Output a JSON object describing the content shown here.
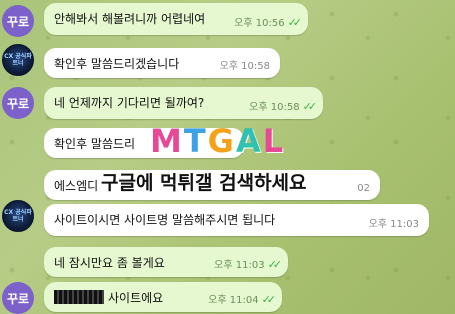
{
  "avatars": {
    "user_label": "꾸로",
    "agent_label": "CX\n공식파트너"
  },
  "messages": [
    {
      "id": "m1",
      "direction": "out",
      "text": "안해봐서 해볼려니까 어렵네여",
      "time": "오후 10:56",
      "ticks": "✓✓"
    },
    {
      "id": "m2",
      "direction": "in",
      "text": "확인후 말씀드리겠습니다",
      "time": "오후 10:58"
    },
    {
      "id": "m3",
      "direction": "out",
      "text": "네 언제까지 기다리면 될까여?",
      "time": "오후 10:58",
      "ticks": "✓✓"
    },
    {
      "id": "m4",
      "direction": "in",
      "text": "확인후 말씀드리",
      "time": ""
    },
    {
      "id": "m5",
      "direction": "in",
      "text": "에스엠디",
      "time": "02"
    },
    {
      "id": "m6",
      "direction": "in",
      "text": "사이트이시면 사이트명 말씀해주시면 됩니다",
      "time": "오후 11:03"
    },
    {
      "id": "m7",
      "direction": "out",
      "text": "네 잠시만요 좀 볼게요",
      "time": "오후 11:03",
      "ticks": "✓✓"
    },
    {
      "id": "m8",
      "direction": "out",
      "text": "사이트에요",
      "time": "오후 11:04",
      "ticks": "✓✓"
    }
  ],
  "watermark": {
    "logo_letters": [
      "M",
      "T",
      "G",
      "A",
      "L"
    ],
    "caption": "구글에 먹튀갤 검색하세요"
  }
}
